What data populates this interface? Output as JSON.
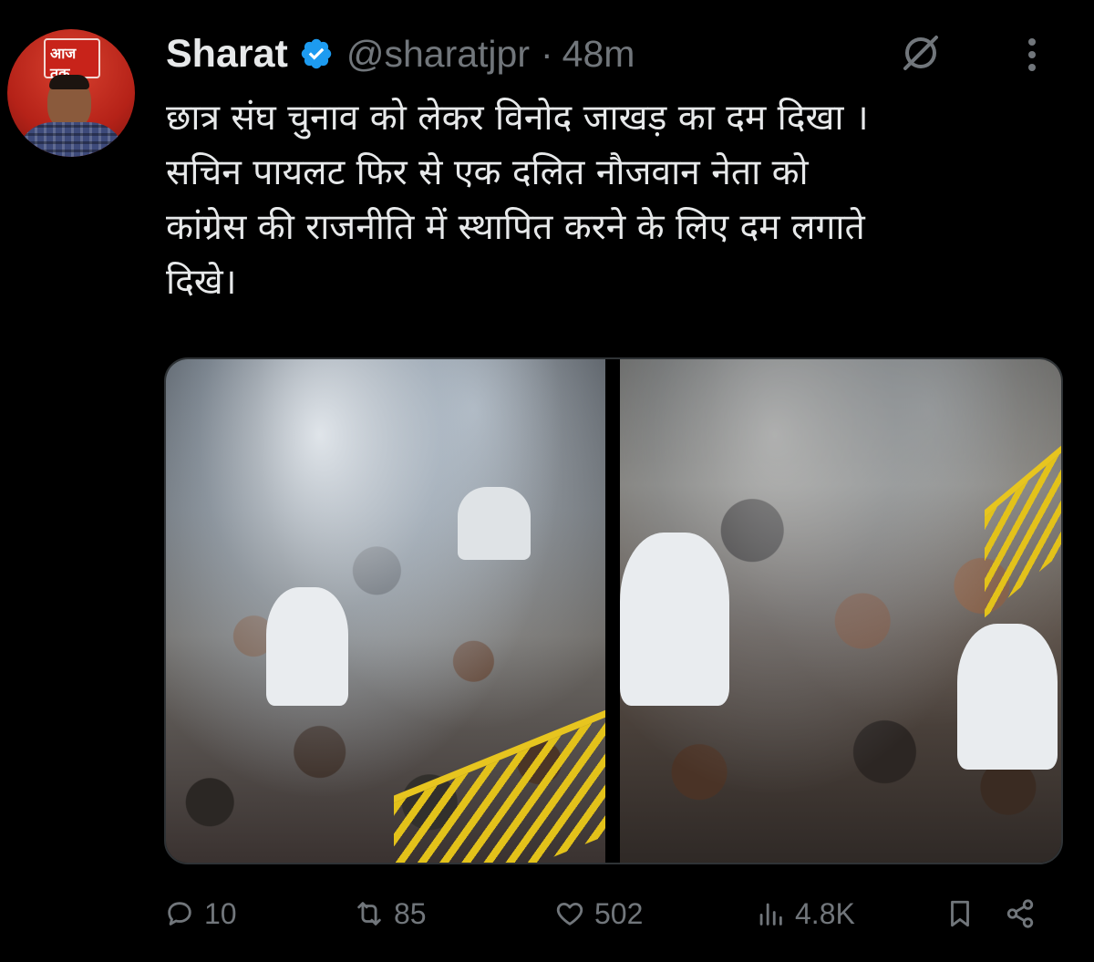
{
  "tweet": {
    "author_name": "Sharat",
    "handle": "@sharatjpr",
    "separator": "·",
    "time": "48m",
    "text": "छात्र संघ चुनाव को लेकर विनोद जाखड़ का दम दिखा ।\nसचिन पायलट फिर से एक दलित नौजवान नेता को\nकांग्रेस की राजनीति में स्थापित करने के लिए दम लगाते\nदिखे।",
    "avatar_logo_text": "आज तक"
  },
  "actions": {
    "replies": "10",
    "reposts": "85",
    "likes": "502",
    "views": "4.8K"
  },
  "icons": {
    "verified": "verified-badge-icon",
    "grok": "grok-icon",
    "more": "more-icon",
    "reply": "reply-icon",
    "repost": "repost-icon",
    "like": "like-icon",
    "views": "views-icon",
    "bookmark": "bookmark-icon",
    "share": "share-icon"
  },
  "colors": {
    "background": "#000000",
    "text": "#e7e9ea",
    "muted": "#71767b",
    "verified": "#1d9bf0",
    "border": "#2f3336"
  }
}
